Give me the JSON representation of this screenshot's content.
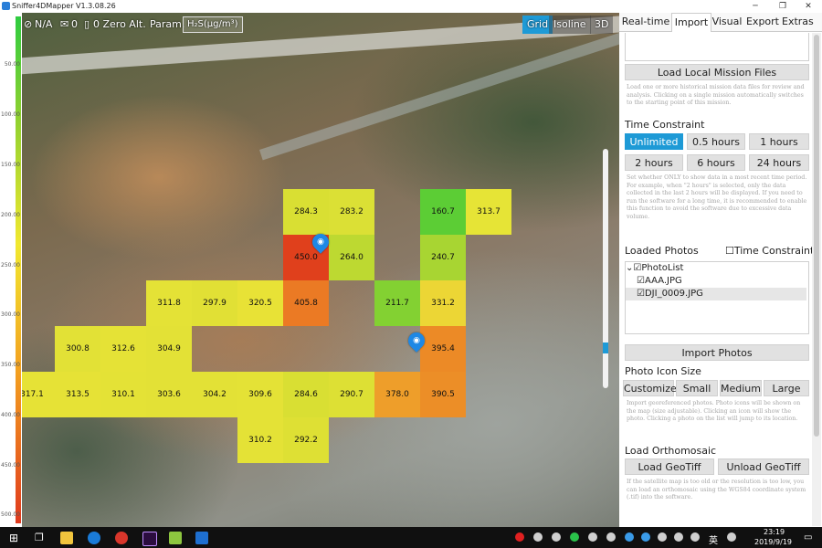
{
  "window": {
    "title": "Sniffer4DMapper V1.3.08.26",
    "minimize": "─",
    "restore": "❐",
    "close": "✕"
  },
  "scale": {
    "ticks": [
      "50.00",
      "100.00",
      "150.00",
      "200.00",
      "250.00",
      "300.00",
      "350.00",
      "400.00",
      "450.00",
      "500.00"
    ]
  },
  "map_toolbar": {
    "signal": "N/A",
    "envelope_count": "0",
    "zero_alt": "0 Zero Alt.",
    "param_label": "Param.",
    "param_value": "H₂S(μg/m³)",
    "views": [
      "Grid",
      "Isoline",
      "3D"
    ],
    "active_view": "Grid"
  },
  "grid": {
    "cells": [
      {
        "v": "284.3",
        "c": "#d9df33"
      },
      {
        "v": "283.2",
        "c": "#dbe035"
      },
      {
        "v": "160.7",
        "c": "#5ccd35"
      },
      {
        "v": "313.7",
        "c": "#e6e436"
      },
      {
        "v": "450.0",
        "c": "#e0401c"
      },
      {
        "v": "264.0",
        "c": "#bdd931"
      },
      {
        "v": "240.7",
        "c": "#a8d532"
      },
      {
        "v": "311.8",
        "c": "#e4e236"
      },
      {
        "v": "297.9",
        "c": "#e1e035"
      },
      {
        "v": "320.5",
        "c": "#e8e236"
      },
      {
        "v": "405.8",
        "c": "#eb7a24"
      },
      {
        "v": "211.7",
        "c": "#83d132"
      },
      {
        "v": "331.2",
        "c": "#ecd635"
      },
      {
        "v": "395.4",
        "c": "#ec8a26"
      },
      {
        "v": "300.8",
        "c": "#e2e136"
      },
      {
        "v": "312.6",
        "c": "#e5e236"
      },
      {
        "v": "304.9",
        "c": "#e3e136"
      },
      {
        "v": "317.1",
        "c": "#e6e236"
      },
      {
        "v": "313.5",
        "c": "#e6e236"
      },
      {
        "v": "310.1",
        "c": "#e4e236"
      },
      {
        "v": "303.6",
        "c": "#e3e136"
      },
      {
        "v": "304.2",
        "c": "#e3e136"
      },
      {
        "v": "309.6",
        "c": "#e4e236"
      },
      {
        "v": "284.6",
        "c": "#d9df33"
      },
      {
        "v": "290.7",
        "c": "#dde034"
      },
      {
        "v": "378.0",
        "c": "#ee9e2a"
      },
      {
        "v": "390.5",
        "c": "#ec8e27"
      },
      {
        "v": "310.2",
        "c": "#e4e236"
      },
      {
        "v": "292.2",
        "c": "#dee034"
      }
    ],
    "photo_icon": "camera-icon"
  },
  "panel": {
    "tabs": [
      "Real-time",
      "Import",
      "Visual",
      "Export",
      "Extras"
    ],
    "active_tab": "Import",
    "load_mission_button": "Load Local Mission Files",
    "load_mission_desc": "Load one or more historical mission data files for review and analysis. Clicking on a single mission automatically switches to the starting point of this mission.",
    "time_constraint_title": "Time Constraint",
    "time_buttons": [
      "Unlimited",
      "0.5 hours",
      "1 hours",
      "2 hours",
      "6 hours",
      "24 hours"
    ],
    "time_active": "Unlimited",
    "time_desc": "Set whether ONLY to show data in a most recent time period. For example, when \"2 hours\" is selected, only the data collected in the last 2 hours will be displayed. If you need to run the software for a long time, it is recommended to enable this function to avoid the software due to excessive data volume.",
    "loaded_photos_title": "Loaded Photos",
    "time_constraint_checkbox": "Time Constraint",
    "photo_list": {
      "root": "PhotoList",
      "items": [
        "AAA.JPG",
        "DJI_0009.JPG"
      ]
    },
    "import_photos_button": "Import Photos",
    "photo_icon_size_title": "Photo Icon Size",
    "size_buttons": [
      "Customize",
      "Small",
      "Medium",
      "Large"
    ],
    "photo_desc": "Import georeferenced photos. Photo icons will be shown on the map (size adjustable). Clicking an icon will show the photo. Clicking a photo on the list will jump to its location.",
    "ortho_title": "Load Orthomosaic",
    "load_geotiff": "Load GeoTiff",
    "unload_geotiff": "Unload GeoTiff",
    "ortho_desc": "If the satellite map is too old or the resolution is too low, you can load an orthomosaic using the WGS84 coordinate system (.tif) into the software."
  },
  "taskbar": {
    "time": "23:19",
    "date": "2019/9/19",
    "ime": "英",
    "apps": [
      "windows-icon",
      "task-view-icon",
      "file-explorer-icon",
      "edge-icon",
      "chrome-icon",
      "premiere-icon",
      "sniffer-icon",
      "sniffer4d-mapper-icon"
    ]
  },
  "colors": {
    "accent": "#1e9ad6",
    "taskbar": "#101010"
  }
}
